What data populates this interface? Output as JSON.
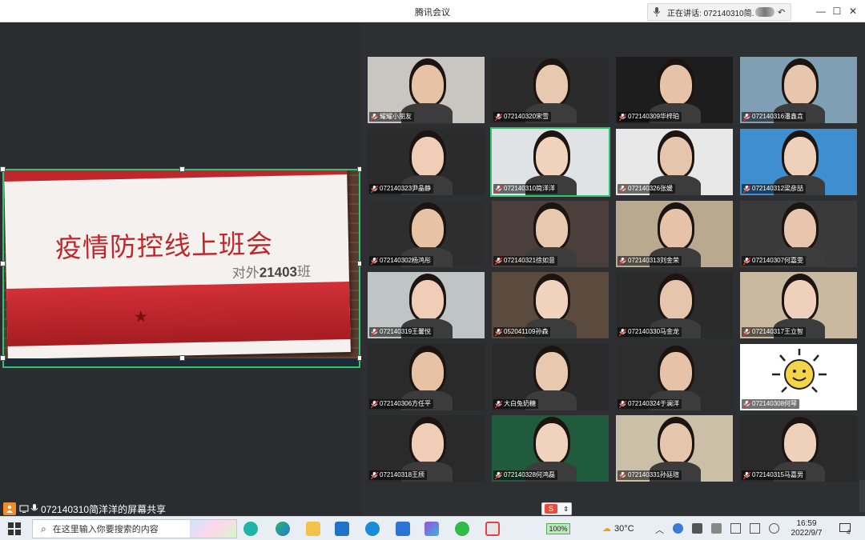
{
  "window": {
    "title": "腾讯会议",
    "speaking_prefix": "正在讲话: ",
    "speaking_name": "072140310简..."
  },
  "share": {
    "slide_title": "疫情防控线上班会",
    "slide_subtitle_prefix": "对外",
    "slide_subtitle_number": "21403",
    "slide_subtitle_suffix": "班",
    "footer_label": "072140310简洋洋的屏幕共享"
  },
  "participants": [
    {
      "name": "耀耀小朋友",
      "active": false
    },
    {
      "name": "072140320宋雪",
      "active": false
    },
    {
      "name": "072140309华梓珀",
      "active": false
    },
    {
      "name": "072140316潘鑫垚",
      "active": false
    },
    {
      "name": "072140323尹晶静",
      "active": false
    },
    {
      "name": "072140310简洋洋",
      "active": true
    },
    {
      "name": "072140326张媛",
      "active": false
    },
    {
      "name": "072140312梁彦喆",
      "active": false
    },
    {
      "name": "072140302杨鸿彤",
      "active": false
    },
    {
      "name": "072140321徐如意",
      "active": false
    },
    {
      "name": "072140313刘金荣",
      "active": false
    },
    {
      "name": "072140307何嘉雯",
      "active": false
    },
    {
      "name": "072140319王馨悦",
      "active": false
    },
    {
      "name": "052041109孙森",
      "active": false
    },
    {
      "name": "072140330马金龙",
      "active": false
    },
    {
      "name": "072140317王立智",
      "active": false
    },
    {
      "name": "072140306方任平",
      "active": false
    },
    {
      "name": "大白兔奶糖",
      "active": false
    },
    {
      "name": "072140324于澜洋",
      "active": false
    },
    {
      "name": "072140308何琴",
      "active": false
    },
    {
      "name": "072140318王颀",
      "active": false
    },
    {
      "name": "072140328何鸿磊",
      "active": false
    },
    {
      "name": "072140331孙廷瑄",
      "active": false
    },
    {
      "name": "072140315马嘉男",
      "active": false
    }
  ],
  "taskbar": {
    "search_placeholder": "在这里输入你要搜索的内容",
    "battery": "100%",
    "temperature": "30°C",
    "time": "16:59",
    "date": "2022/9/7",
    "notification_count": "4"
  },
  "colors": {
    "accent": "#31c46f",
    "slide_red": "#c0272d",
    "window_bg": "#2b2d31"
  }
}
